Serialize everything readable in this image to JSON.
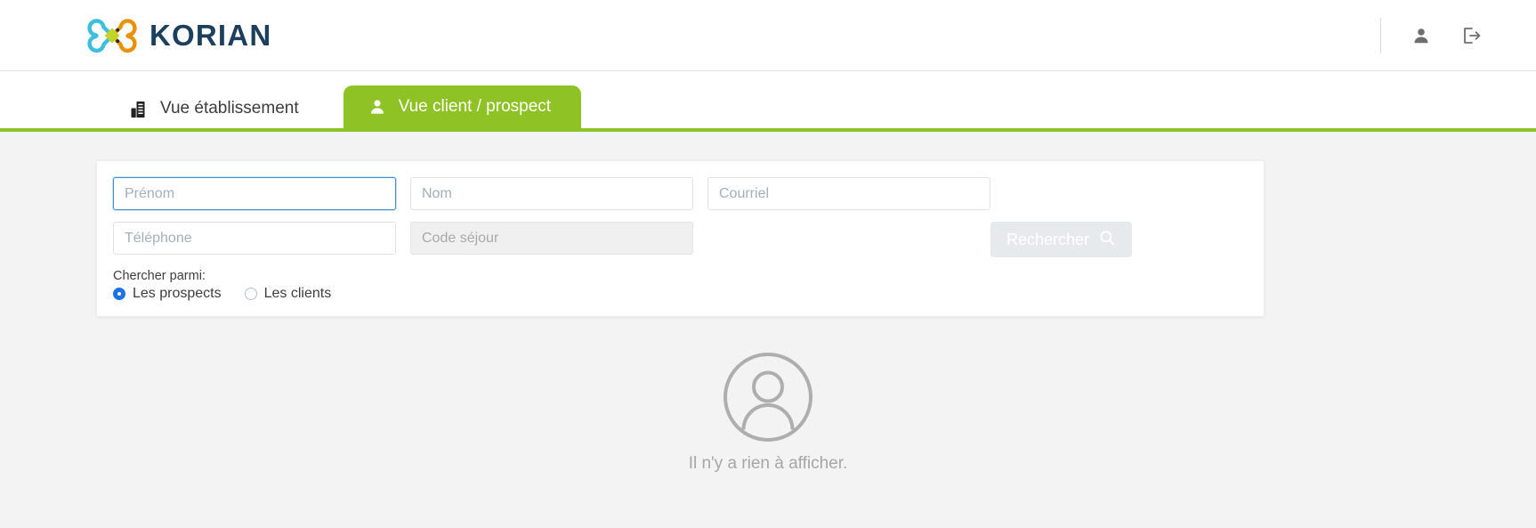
{
  "header": {
    "brand_word": "KORIAN",
    "brand_logo_icon": "korian-butterfly-logo",
    "account_icon": "user-icon",
    "logout_icon": "logout-icon",
    "colors": {
      "brand_text": "#1c3f5e",
      "logo_blue": "#3cbfde",
      "logo_orange": "#e8920a",
      "logo_green": "#c4d22a"
    }
  },
  "tabs": [
    {
      "label": "Vue établissement",
      "icon": "building-icon",
      "active": false
    },
    {
      "label": "Vue client / prospect",
      "icon": "user-icon",
      "active": true
    }
  ],
  "tabbar": {
    "accent_color": "#8ec225"
  },
  "search": {
    "fields": [
      {
        "name": "prenom",
        "placeholder": "Prénom",
        "value": "",
        "state": "focused"
      },
      {
        "name": "nom",
        "placeholder": "Nom",
        "value": "",
        "state": "normal"
      },
      {
        "name": "courriel",
        "placeholder": "Courriel",
        "value": "",
        "state": "normal"
      },
      {
        "name": "telephone",
        "placeholder": "Téléphone",
        "value": "",
        "state": "normal"
      },
      {
        "name": "code_sejour",
        "placeholder": "Code séjour",
        "value": "",
        "state": "disabled"
      }
    ],
    "submit_label": "Rechercher",
    "submit_icon": "search-icon",
    "submit_disabled": true,
    "radio_group_label": "Chercher parmi:",
    "radios": [
      {
        "label": "Les prospects",
        "selected": true
      },
      {
        "label": "Les clients",
        "selected": false
      }
    ]
  },
  "empty_state": {
    "icon": "avatar-placeholder-icon",
    "message": "Il n'y a rien à afficher."
  }
}
